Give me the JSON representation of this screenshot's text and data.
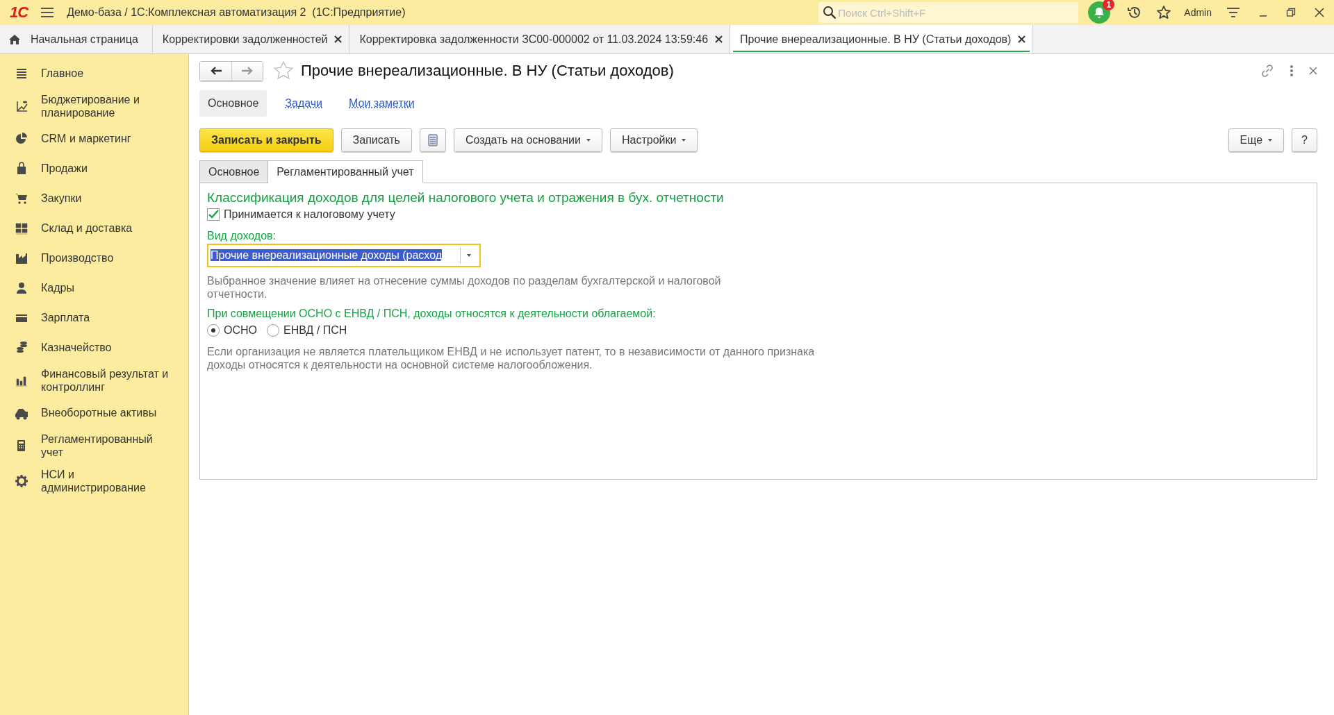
{
  "window": {
    "logo": "1С",
    "title": "Демо-база / 1С:Комплексная автоматизация 2  (1С:Предприятие)",
    "search": {
      "placeholder": "Поиск Ctrl+Shift+F"
    },
    "notifications": "1",
    "user": "Admin"
  },
  "tabs": [
    {
      "label": "Начальная страница",
      "kind": "home",
      "selected": false
    },
    {
      "label": "Корректировки задолженностей",
      "kind": "closable",
      "selected": false
    },
    {
      "label": "Корректировка задолженности ЗС00-000002 от 11.03.2024 13:59:46",
      "kind": "closable",
      "selected": false
    },
    {
      "label": "Прочие внереализационные. В НУ (Статьи доходов)",
      "kind": "closable",
      "selected": true
    }
  ],
  "sidebar": {
    "items": [
      {
        "label": "Главное"
      },
      {
        "label": "Бюджетирование и планирование"
      },
      {
        "label": "CRM и маркетинг"
      },
      {
        "label": "Продажи"
      },
      {
        "label": "Закупки"
      },
      {
        "label": "Склад и доставка"
      },
      {
        "label": "Производство"
      },
      {
        "label": "Кадры"
      },
      {
        "label": "Зарплата"
      },
      {
        "label": "Казначейство"
      },
      {
        "label": "Финансовый результат и контроллинг"
      },
      {
        "label": "Внеоборотные активы"
      },
      {
        "label": "Регламентированный учет"
      },
      {
        "label": "НСИ и администрирование"
      }
    ]
  },
  "form": {
    "title": "Прочие внереализационные. В НУ (Статьи доходов)",
    "starred": false,
    "nav_tabs": [
      {
        "label": "Основное",
        "selected": true
      },
      {
        "label": "Задачи",
        "selected": false
      },
      {
        "label": "Мои заметки",
        "selected": false
      }
    ],
    "commands": [
      {
        "kind": "primary",
        "label": "Записать и закрыть"
      },
      {
        "kind": "plain",
        "label": "Записать"
      },
      {
        "kind": "icon"
      },
      {
        "kind": "dropdown",
        "label": "Создать на основании"
      },
      {
        "kind": "dropdown",
        "label": "Настройки"
      }
    ],
    "more": "Еще",
    "help": "?",
    "tabs": [
      {
        "label": "Основное",
        "selected": false
      },
      {
        "label": "Регламентированный учет",
        "selected": true
      }
    ],
    "section_title": "Классификация доходов для целей налогового учета и отражения в бух. отчетности",
    "tax_accounting": {
      "label": "Принимается к налоговому учету",
      "checked": true
    },
    "income_type": {
      "label": "Вид доходов:",
      "value": "Прочие внереализационные доходы (расход",
      "focused": true
    },
    "income_hint": "Выбранное значение влияет на отнесение суммы доходов по разделам бухгалтерской и налоговой отчетности.",
    "taxation": {
      "label": "При совмещении ОСНО с ЕНВД / ПСН, доходы относятся к деятельности облагаемой:",
      "options": [
        {
          "label": "ОСНО",
          "selected": true
        },
        {
          "label": "ЕНВД / ПСН",
          "selected": false
        }
      ]
    },
    "taxation_hint": "Если организация не является плательщиком ЕНВД и не использует патент, то в независимости от данного признака доходы относятся к деятельности на основной системе налогообложения."
  }
}
